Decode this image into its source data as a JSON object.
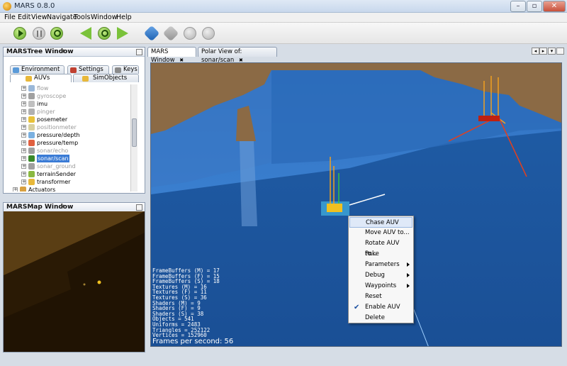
{
  "window": {
    "title": "MARS 0.8.0"
  },
  "menu": [
    "File",
    "Edit",
    "View",
    "Navigate",
    "Tools",
    "Window",
    "Help"
  ],
  "toolbar": [
    {
      "name": "start-button",
      "icon": "play-icon"
    },
    {
      "name": "pause-button",
      "icon": "pause-icon"
    },
    {
      "name": "restart-button",
      "icon": "restart-icon"
    },
    {
      "name": "back-button",
      "icon": "arrow-left-icon"
    },
    {
      "name": "time-button",
      "icon": "clock-icon"
    },
    {
      "name": "forward-button",
      "icon": "arrow-right-icon"
    },
    {
      "name": "connect-button",
      "icon": "connect-icon"
    },
    {
      "name": "disconnect-button",
      "icon": "disconnect-icon"
    },
    {
      "name": "record-button",
      "icon": "record-icon"
    },
    {
      "name": "stop-button",
      "icon": "stop-icon"
    }
  ],
  "tree_panel": {
    "title": "MARSTree Window",
    "tabs_row1": [
      "Environment",
      "Settings",
      "Keys"
    ],
    "tabs_row2": [
      "AUVs",
      "SimObjects"
    ],
    "items": [
      {
        "label": "flow",
        "grey": true,
        "icon_color": "#9bb8d8"
      },
      {
        "label": "gyroscope",
        "grey": true,
        "icon_color": "#a0a0a0"
      },
      {
        "label": "imu",
        "grey": false,
        "icon_color": "#c0c0c0"
      },
      {
        "label": "pinger",
        "grey": true,
        "icon_color": "#b0b0b0"
      },
      {
        "label": "posemeter",
        "grey": false,
        "icon_color": "#e8c23a"
      },
      {
        "label": "positionmeter",
        "grey": true,
        "icon_color": "#d8d0a0"
      },
      {
        "label": "pressure/depth",
        "grey": false,
        "icon_color": "#7ab0e0"
      },
      {
        "label": "pressure/temp",
        "grey": false,
        "icon_color": "#e06040"
      },
      {
        "label": "sonar/echo",
        "grey": true,
        "icon_color": "#a0a0a0"
      },
      {
        "label": "sonar/scan",
        "grey": false,
        "selected": true,
        "icon_color": "#3a8a2a"
      },
      {
        "label": "sonar_ground",
        "grey": true,
        "icon_color": "#a0a0a0"
      },
      {
        "label": "terrainSender",
        "grey": false,
        "icon_color": "#8ab840"
      },
      {
        "label": "transformer",
        "grey": false,
        "icon_color": "#e8b83a"
      },
      {
        "label": "Actuators",
        "grey": false,
        "root": true,
        "icon_color": "#d8a040"
      }
    ]
  },
  "map_panel": {
    "title": "MARSMap Window"
  },
  "viewport_tabs": [
    "MARS Window",
    "Polar View of: sonar/scan"
  ],
  "stats": [
    "FrameBuffers (M) = 17",
    "FrameBuffers (F) = 15",
    "FrameBuffers (S) = 18",
    "Textures (M) = 16",
    "Textures (F) = 11",
    "Textures (S) = 36",
    "Shaders (M) = 9",
    "Shaders (F) = 9",
    "Shaders (S) = 38",
    "Objects = 541",
    "Uniforms = 2483",
    "Triangles = 252122",
    "Vertices = 152960"
  ],
  "fps": "Frames per second: 56",
  "context_menu": [
    {
      "label": "Chase AUV",
      "highlight": true
    },
    {
      "label": "Move AUV to..."
    },
    {
      "label": "Rotate AUV to..."
    },
    {
      "label": "Poke"
    },
    {
      "label": "Parameters",
      "submenu": true
    },
    {
      "label": "Debug",
      "submenu": true
    },
    {
      "label": "Waypoints",
      "submenu": true
    },
    {
      "label": "Reset"
    },
    {
      "label": "Enable AUV",
      "checked": true
    },
    {
      "label": "Delete"
    }
  ],
  "colors": {
    "water": "#1d5ba3",
    "terrain": "#8a6a45",
    "map_ground": "#5a3e14",
    "selection": "#3a7bd5"
  }
}
